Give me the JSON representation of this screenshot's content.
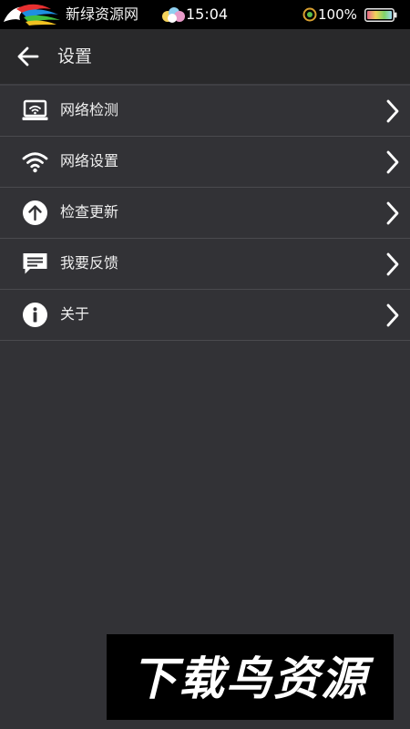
{
  "status_bar": {
    "brand": "新绿资源网",
    "time": "15:04",
    "battery_percent": "100%",
    "battery_level": 1.0
  },
  "header": {
    "title": "设置"
  },
  "settings": {
    "items": [
      {
        "label": "网络检测",
        "icon": "laptop-wifi-icon"
      },
      {
        "label": "网络设置",
        "icon": "wifi-icon"
      },
      {
        "label": "检查更新",
        "icon": "arrow-up-circle-icon"
      },
      {
        "label": "我要反馈",
        "icon": "feedback-message-icon"
      },
      {
        "label": "关于",
        "icon": "info-icon"
      }
    ]
  },
  "watermark": {
    "text": "下载鸟资源"
  }
}
